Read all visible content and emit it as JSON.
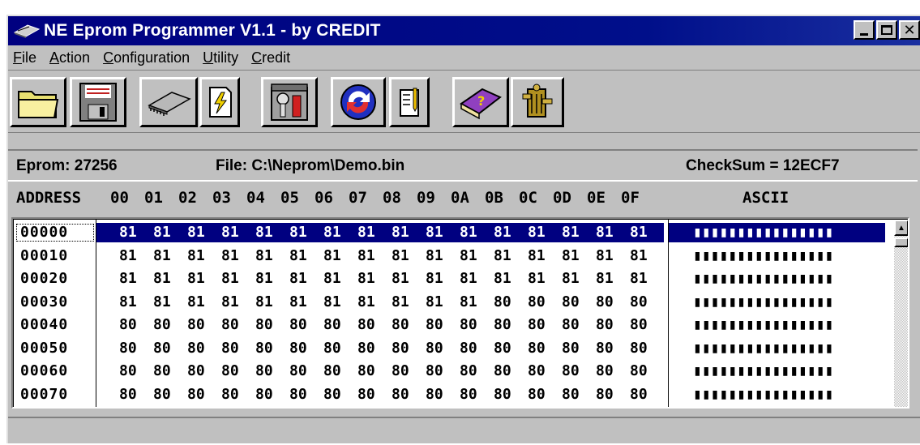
{
  "window": {
    "title": "NE Eprom Programmer V1.1  -  by CREDIT",
    "icon": "eprom-chip-icon"
  },
  "menu": [
    {
      "label": "File",
      "hotkey": "F",
      "rest": "ile"
    },
    {
      "label": "Action",
      "hotkey": "A",
      "rest": "ction"
    },
    {
      "label": "Configuration",
      "hotkey": "C",
      "rest": "onfiguration"
    },
    {
      "label": "Utility",
      "hotkey": "U",
      "rest": "tility"
    },
    {
      "label": "Credit",
      "hotkey": "C",
      "rest": "redit"
    }
  ],
  "toolbar": {
    "buttons": [
      "open-folder-icon",
      "save-disk-icon",
      "eprom-chip-icon",
      "flash-file-icon",
      "tools-icon",
      "refresh-icon",
      "edit-pencil-icon",
      "help-book-icon",
      "about-icon"
    ]
  },
  "info": {
    "eprom": "Eprom:  27256",
    "file": "File: C:\\Neprom\\Demo.bin",
    "checksum": "CheckSum = 12ECF7"
  },
  "columns": {
    "address": "ADDRESS",
    "bytes": [
      "00",
      "01",
      "02",
      "03",
      "04",
      "05",
      "06",
      "07",
      "08",
      "09",
      "0A",
      "0B",
      "0C",
      "0D",
      "0E",
      "0F"
    ],
    "ascii": "ASCII"
  },
  "rows": [
    {
      "address": "00000",
      "bytes": [
        "81",
        "81",
        "81",
        "81",
        "81",
        "81",
        "81",
        "81",
        "81",
        "81",
        "81",
        "81",
        "81",
        "81",
        "81",
        "81"
      ],
      "ascii": "▮▮▮▮▮▮▮▮▮▮▮▮▮▮▮▮"
    },
    {
      "address": "00010",
      "bytes": [
        "81",
        "81",
        "81",
        "81",
        "81",
        "81",
        "81",
        "81",
        "81",
        "81",
        "81",
        "81",
        "81",
        "81",
        "81",
        "81"
      ],
      "ascii": "▮▮▮▮▮▮▮▮▮▮▮▮▮▮▮▮"
    },
    {
      "address": "00020",
      "bytes": [
        "81",
        "81",
        "81",
        "81",
        "81",
        "81",
        "81",
        "81",
        "81",
        "81",
        "81",
        "81",
        "81",
        "81",
        "81",
        "81"
      ],
      "ascii": "▮▮▮▮▮▮▮▮▮▮▮▮▮▮▮▮"
    },
    {
      "address": "00030",
      "bytes": [
        "81",
        "81",
        "81",
        "81",
        "81",
        "81",
        "81",
        "81",
        "81",
        "81",
        "81",
        "80",
        "80",
        "80",
        "80",
        "80"
      ],
      "ascii": "▮▮▮▮▮▮▮▮▮▮▮▮▮▮▮▮"
    },
    {
      "address": "00040",
      "bytes": [
        "80",
        "80",
        "80",
        "80",
        "80",
        "80",
        "80",
        "80",
        "80",
        "80",
        "80",
        "80",
        "80",
        "80",
        "80",
        "80"
      ],
      "ascii": "▮▮▮▮▮▮▮▮▮▮▮▮▮▮▮▮"
    },
    {
      "address": "00050",
      "bytes": [
        "80",
        "80",
        "80",
        "80",
        "80",
        "80",
        "80",
        "80",
        "80",
        "80",
        "80",
        "80",
        "80",
        "80",
        "80",
        "80"
      ],
      "ascii": "▮▮▮▮▮▮▮▮▮▮▮▮▮▮▮▮"
    },
    {
      "address": "00060",
      "bytes": [
        "80",
        "80",
        "80",
        "80",
        "80",
        "80",
        "80",
        "80",
        "80",
        "80",
        "80",
        "80",
        "80",
        "80",
        "80",
        "80"
      ],
      "ascii": "▮▮▮▮▮▮▮▮▮▮▮▮▮▮▮▮"
    },
    {
      "address": "00070",
      "bytes": [
        "80",
        "80",
        "80",
        "80",
        "80",
        "80",
        "80",
        "80",
        "80",
        "80",
        "80",
        "80",
        "80",
        "80",
        "80",
        "80"
      ],
      "ascii": "▮▮▮▮▮▮▮▮▮▮▮▮▮▮▮▮"
    }
  ],
  "selected_row": 0,
  "scrollbar": {
    "up_icon": "scroll-up-arrow-icon"
  },
  "colors": {
    "title_bg": "#000080",
    "window_bg": "#c0c0c0",
    "selection": "#000080"
  }
}
